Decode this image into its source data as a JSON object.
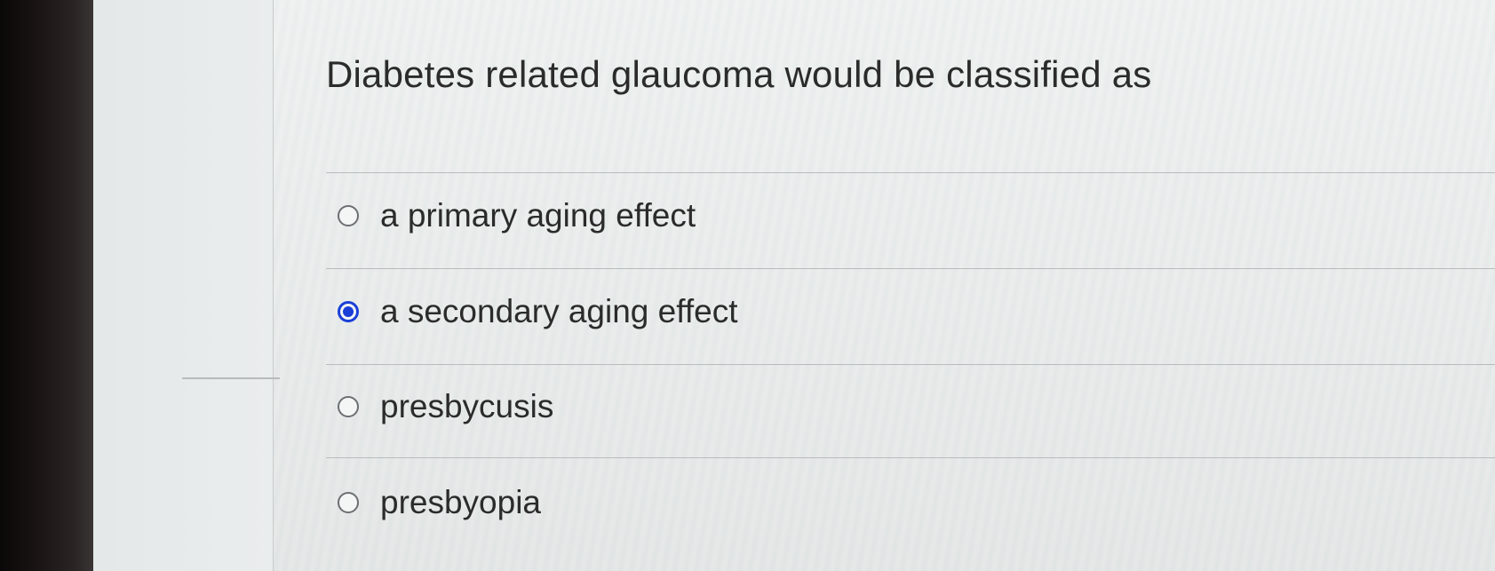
{
  "quiz": {
    "question": "Diabetes related glaucoma would be classified as",
    "options": [
      {
        "label": "a primary aging effect",
        "selected": false
      },
      {
        "label": "a secondary aging effect",
        "selected": true
      },
      {
        "label": "presbycusis",
        "selected": false
      },
      {
        "label": "presbyopia",
        "selected": false
      }
    ],
    "accent_color": "#1a3fd8"
  }
}
